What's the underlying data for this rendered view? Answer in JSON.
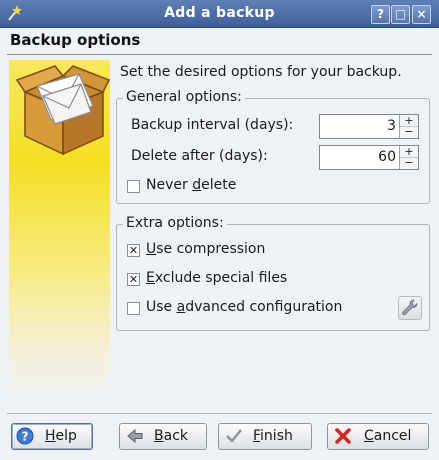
{
  "window": {
    "title": "Add a backup",
    "title_buttons": [
      "?",
      "□",
      "×"
    ]
  },
  "header": {
    "title": "Backup options"
  },
  "intro": "Set the desired options for your backup.",
  "general": {
    "title": "General options:",
    "interval": {
      "label": "Backup interval (days):",
      "value": "3"
    },
    "delete_after": {
      "label": "Delete after (days):",
      "value": "60"
    },
    "never_delete": {
      "prefix": "Never ",
      "mnemonic": "d",
      "suffix": "elete",
      "checked": false
    }
  },
  "extra": {
    "title": "Extra options:",
    "compression": {
      "prefix": "",
      "mnemonic": "U",
      "suffix": "se compression",
      "checked": true
    },
    "exclude": {
      "prefix": "",
      "mnemonic": "E",
      "suffix": "xclude special files",
      "checked": true
    },
    "advanced": {
      "prefix": "Use ",
      "mnemonic": "a",
      "suffix": "dvanced configuration",
      "checked": false
    }
  },
  "buttons": {
    "help": {
      "mnemonic": "H",
      "rest": "elp"
    },
    "back": {
      "mnemonic": "B",
      "rest": "ack"
    },
    "finish": {
      "mnemonic": "F",
      "rest": "inish"
    },
    "cancel": {
      "mnemonic": "C",
      "rest": "ancel"
    }
  },
  "colors": {
    "titlebar": "#4a6aa3",
    "side_yellow": "#f5df24",
    "cancel_red": "#d42a1e"
  },
  "icons": [
    "app-wand-icon",
    "help-icon",
    "maximize-icon",
    "close-icon",
    "package-icon",
    "wrench-icon",
    "question-icon",
    "back-arrow-icon",
    "checkmark-icon",
    "cancel-x-icon"
  ]
}
